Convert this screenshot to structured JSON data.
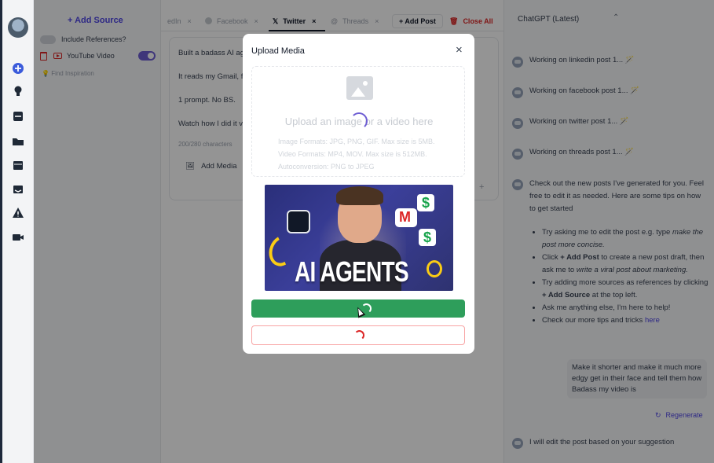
{
  "sources": {
    "add_source_label": "+ Add Source",
    "include_references_label": "Include References?",
    "items": [
      {
        "label": "YouTube Video"
      }
    ],
    "find_inspiration_label": "Find Inspiration"
  },
  "tabs": {
    "items": [
      {
        "label": "edIn"
      },
      {
        "label": "Facebook"
      },
      {
        "label": "Twitter"
      },
      {
        "label": "Threads"
      }
    ],
    "close_glyph": "×",
    "add_post_label": "+ Add Post",
    "close_all_label": "Close All"
  },
  "editor": {
    "lines": [
      "Built a badass AI ag",
      "It reads my Gmail, f",
      "1 prompt. No BS.",
      "Watch how I did it v"
    ],
    "char_count": "200/280 characters",
    "add_media_label": "Add Media"
  },
  "chat": {
    "model": "ChatGPT (Latest)",
    "status_messages": [
      "Working on linkedin post 1... 🪄",
      "Working on facebook post 1... 🪄",
      "Working on twitter post 1... 🪄",
      "Working on threads post 1... 🪄"
    ],
    "tips_intro": "Check out the new posts I've generated for you. Feel free to edit it as needed. Here are some tips on how to get started",
    "tips": [
      {
        "a": "Try asking me to edit the post e.g. type ",
        "b": "make the post more concise."
      },
      {
        "a": "Click ",
        "b": "+ Add Post",
        "c": " to create a new post draft, then ask me to ",
        "d": "write a viral post about marketing."
      },
      {
        "a": "Try adding more sources as references by clicking ",
        "b": "+ Add Source",
        "c": " at the top left."
      },
      {
        "a": "Ask me anything else, I'm here to help!"
      },
      {
        "a": "Check our more tips and tricks ",
        "b": "here"
      }
    ],
    "user_message": "Make it shorter and make it much more edgy get in their face and tell them how Badass my video is",
    "regenerate_label": "Regenerate",
    "last_message": "I will edit the post based on your suggestion"
  },
  "modal": {
    "title": "Upload Media",
    "close_glyph": "×",
    "dropzone_title": "Upload an image or a video here",
    "dropzone_info": [
      "Image Formats: JPG, PNG, GIF. Max size is 5MB.",
      "Video Formats: MP4, MOV. Max size is 512MB.",
      "Autoconversion: PNG to JPEG"
    ],
    "thumbnail_text": "AI AGENTS",
    "thumbnail_dollar": "$"
  },
  "colors": {
    "accent": "#4f46e5",
    "toggle_on": "#6d5dd3",
    "confirm_button": "#2e9e5b",
    "danger": "#dc2626"
  },
  "icons": [
    "avatar",
    "plus-circle-icon",
    "lightbulb-icon",
    "inbox-icon",
    "folder-icon",
    "calendar-icon",
    "tray-icon",
    "warning-icon",
    "video-icon"
  ]
}
